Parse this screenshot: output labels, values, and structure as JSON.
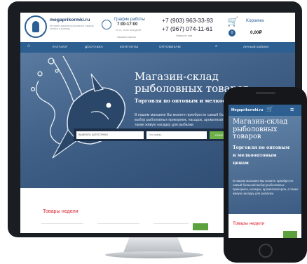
{
  "site": {
    "brand": "megaprikormki.ru",
    "brand_tagline": "Интернет-магазин рыболовных товаров оптом и в розницу"
  },
  "schedule": {
    "title": "График работы",
    "hours": "7:00-17:00",
    "days": "пн-пт, сб-вс выходной",
    "callback": "Заказать звонок"
  },
  "contacts": {
    "phone1": "+7 (903) 963-33-93",
    "phone2": "+7 (967) 074-11-61",
    "email_label": "Написать нам"
  },
  "cart": {
    "title": "Корзина",
    "count": "0",
    "total": "0,00₽"
  },
  "nav": {
    "items": [
      "КАТАЛОГ",
      "ДОСТАВКА",
      "КОНТАКТЫ",
      "ОПТОВИКАМ"
    ],
    "account": "Личный кабинет"
  },
  "hero": {
    "title": "Магазин-склад\nрыболовных товаров",
    "subtitle": "Торговля по оптовым и мелкооптовым ценам",
    "description": "В нашем магазине Вы можете приобрести самый большой выбор рыболовных прикормок, насадок, ароматизаторов, а также живую насадку для рыбалки."
  },
  "search": {
    "category_placeholder": "ВЫБРАТЬ КАТЕГОРИЮ",
    "input_placeholder": "Что ищем...",
    "button_label": "ПОИСК"
  },
  "weekly_title": "Товары недели",
  "mobile": {
    "brand": "Megaprikormki.ru",
    "hero_title": "Магазин-склад\nрыболовных\nтоваров",
    "hero_subtitle": "Торговля по оптовым\nи мелкооптовым\nценам",
    "hero_description": "В нашем магазине Вы можете приобрести самый большой выбор рыболовных прикормок, насадок, ароматизаторов, а также живую насадку для рыбалки.",
    "weekly_title": "Товары недели"
  },
  "colors": {
    "accent": "#2e5f91",
    "green": "#5ca23c",
    "red": "#d22233"
  }
}
